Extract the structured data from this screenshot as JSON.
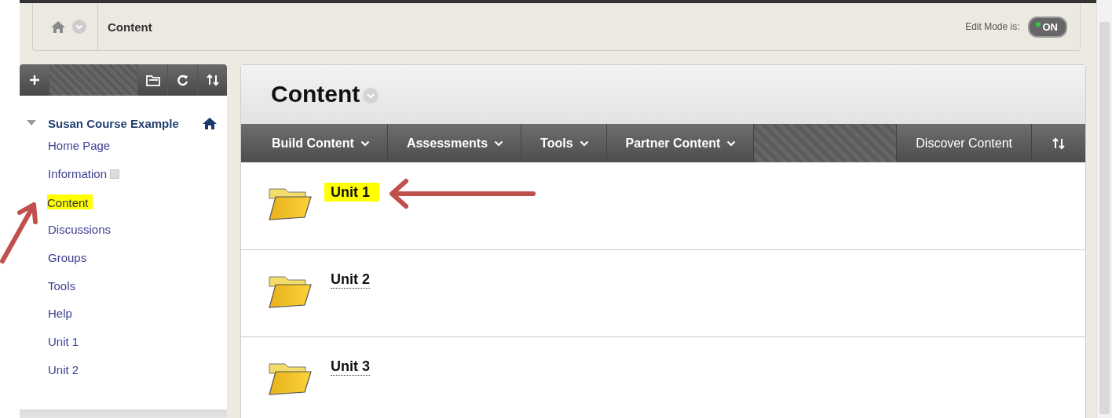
{
  "breadcrumb": {
    "current": "Content"
  },
  "edit_mode": {
    "label": "Edit Mode is:",
    "state": "ON",
    "on": true
  },
  "course_menu": {
    "title": "Susan Course Example",
    "expanded": true,
    "items": [
      {
        "label": "Home Page",
        "highlighted": false,
        "arrow": false,
        "flagged": false
      },
      {
        "label": "Information",
        "highlighted": false,
        "arrow": false,
        "flagged": true
      },
      {
        "label": "Content",
        "highlighted": true,
        "arrow": true,
        "flagged": false
      },
      {
        "label": "Discussions",
        "highlighted": false,
        "arrow": false,
        "flagged": false
      },
      {
        "label": "Groups",
        "highlighted": false,
        "arrow": false,
        "flagged": false
      },
      {
        "label": "Tools",
        "highlighted": false,
        "arrow": false,
        "flagged": false
      },
      {
        "label": "Help",
        "highlighted": false,
        "arrow": false,
        "flagged": false
      },
      {
        "label": "Unit 1",
        "highlighted": false,
        "arrow": false,
        "flagged": false
      },
      {
        "label": "Unit 2",
        "highlighted": false,
        "arrow": false,
        "flagged": false
      }
    ]
  },
  "page": {
    "title": "Content",
    "toolbar": [
      {
        "label": "Build Content",
        "kind": "menu"
      },
      {
        "label": "Assessments",
        "kind": "menu"
      },
      {
        "label": "Tools",
        "kind": "menu"
      },
      {
        "label": "Partner Content",
        "kind": "menu"
      },
      {
        "label": "Discover Content",
        "kind": "link"
      }
    ],
    "items": [
      {
        "title": "Unit 1",
        "highlighted": true,
        "arrow": true
      },
      {
        "title": "Unit 2",
        "highlighted": false,
        "arrow": false
      },
      {
        "title": "Unit 3",
        "highlighted": false,
        "arrow": false
      }
    ]
  }
}
